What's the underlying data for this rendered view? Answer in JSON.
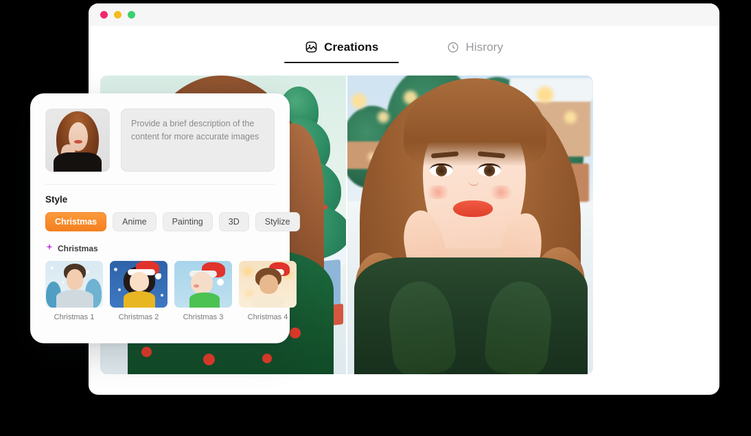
{
  "window": {
    "traffic_lights": [
      {
        "name": "close",
        "color": "#f4276a"
      },
      {
        "name": "minimize",
        "color": "#f5bb1f"
      },
      {
        "name": "maximize",
        "color": "#3ed06e"
      }
    ]
  },
  "tabs": [
    {
      "label": "Creations",
      "icon": "image-icon",
      "active": true
    },
    {
      "label": "Hisrory",
      "icon": "clock-icon",
      "active": false
    }
  ],
  "results": [
    {
      "name": "generated-image-1",
      "alt": "Illustrated portrait of woman with auburn hair in green polka-dot sweater on mint background with Christmas tree"
    },
    {
      "name": "generated-image-2",
      "alt": "3D rendered portrait of woman with wavy auburn hair in dark green sweater in snowy village with Christmas trees and bokeh lights"
    }
  ],
  "panel": {
    "reference_image": {
      "name": "uploaded-reference-photo",
      "alt": "Photo of woman with auburn hair in black top"
    },
    "prompt": {
      "value": "",
      "placeholder": "Provide a brief description of the content for more accurate images"
    },
    "style": {
      "title": "Style",
      "chips": [
        {
          "label": "Christmas",
          "active": true
        },
        {
          "label": "Anime",
          "active": false
        },
        {
          "label": "Painting",
          "active": false
        },
        {
          "label": "3D",
          "active": false
        },
        {
          "label": "Stylize",
          "active": false
        }
      ],
      "accent_color": "#f5801f"
    },
    "subsection": {
      "icon": "sparkle-icon",
      "icon_color": "#c04ddb",
      "label": "Christmas",
      "presets": [
        {
          "label": "Christmas 1"
        },
        {
          "label": "Christmas 2"
        },
        {
          "label": "Christmas 3"
        },
        {
          "label": "Christmas 4"
        }
      ]
    }
  }
}
